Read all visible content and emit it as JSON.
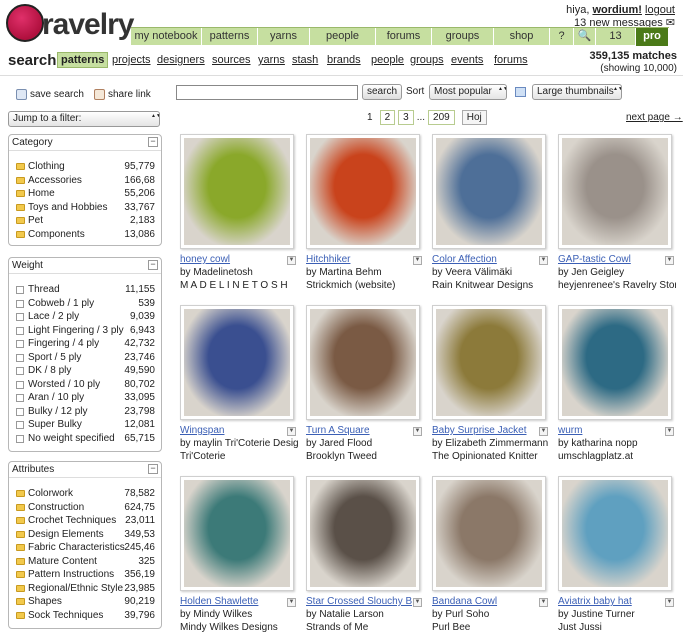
{
  "header": {
    "logo_text": "ravelry",
    "user_greeting": "hiya, ",
    "username": "wordium!",
    "logout": "logout",
    "messages": "13 new messages"
  },
  "nav": {
    "tabs": [
      "my notebook",
      "patterns",
      "yarns",
      "people",
      "forums",
      "groups",
      "shop",
      "?",
      "🔍",
      "13",
      "pro"
    ]
  },
  "subnav": {
    "title": "search",
    "items": [
      "patterns",
      "projects",
      "designers",
      "sources",
      "yarns",
      "stash",
      "brands",
      "people",
      "groups",
      "events",
      "forums"
    ],
    "active": "patterns"
  },
  "matches": {
    "count": "359,135 matches",
    "showing": "(showing 10,000)"
  },
  "toolbar": {
    "save_search": "save search",
    "share_link": "share link",
    "search_button": "search",
    "sort_label": "Sort",
    "sort_value": "Most popular",
    "view_value": "Large thumbnails",
    "search_value": ""
  },
  "jump": {
    "label": "Jump to a filter:"
  },
  "pager": {
    "pages": [
      "1",
      "2",
      "3",
      "...",
      "209"
    ],
    "current": "1",
    "per_page": "Hoj",
    "next": "next page →"
  },
  "filters": {
    "category": {
      "title": "Category",
      "items": [
        {
          "label": "Clothing",
          "count": "95,779"
        },
        {
          "label": "Accessories",
          "count": "166,68"
        },
        {
          "label": "Home",
          "count": "55,206"
        },
        {
          "label": "Toys and Hobbies",
          "count": "33,767"
        },
        {
          "label": "Pet",
          "count": "2,183"
        },
        {
          "label": "Components",
          "count": "13,086"
        }
      ]
    },
    "weight": {
      "title": "Weight",
      "items": [
        {
          "label": "Thread",
          "count": "11,155"
        },
        {
          "label": "Cobweb / 1 ply",
          "count": "539"
        },
        {
          "label": "Lace / 2 ply",
          "count": "9,039"
        },
        {
          "label": "Light Fingering / 3 ply",
          "count": "6,943"
        },
        {
          "label": "Fingering / 4 ply",
          "count": "42,732"
        },
        {
          "label": "Sport / 5 ply",
          "count": "23,746"
        },
        {
          "label": "DK / 8 ply",
          "count": "49,590"
        },
        {
          "label": "Worsted / 10 ply",
          "count": "80,702"
        },
        {
          "label": "Aran / 10 ply",
          "count": "33,095"
        },
        {
          "label": "Bulky / 12 ply",
          "count": "23,798"
        },
        {
          "label": "Super Bulky",
          "count": "12,081"
        },
        {
          "label": "No weight specified",
          "count": "65,715"
        }
      ]
    },
    "attributes": {
      "title": "Attributes",
      "items": [
        {
          "label": "Colorwork",
          "count": "78,582"
        },
        {
          "label": "Construction",
          "count": "624,75"
        },
        {
          "label": "Crochet Techniques",
          "count": "23,011"
        },
        {
          "label": "Design Elements",
          "count": "349,53"
        },
        {
          "label": "Fabric Characteristics",
          "count": "245,46"
        },
        {
          "label": "Mature Content",
          "count": "325"
        },
        {
          "label": "Pattern Instructions",
          "count": "356,19"
        },
        {
          "label": "Regional/Ethnic Style",
          "count": "23,985"
        },
        {
          "label": "Shapes",
          "count": "90,219"
        },
        {
          "label": "Sock Techniques",
          "count": "39,796"
        }
      ]
    }
  },
  "results": [
    {
      "title": "honey cowl",
      "by": "by Madelinetosh",
      "source": "M A D E L I N E T O S H",
      "color": "#8aa82a"
    },
    {
      "title": "Hitchhiker",
      "by": "by Martina Behm",
      "source": "Strickmich (website)",
      "color": "#c9431c"
    },
    {
      "title": "Color Affection",
      "by": "by Veera Välimäki",
      "source": "Rain Knitwear Designs",
      "color": "#4e6f98"
    },
    {
      "title": "GAP-tastic Cowl",
      "by": "by Jen Geigley",
      "source": "heyjenrenee's Ravelry Store",
      "color": "#9a918a"
    },
    {
      "title": "Wingspan",
      "by": "by maylin Tri'Coterie Designs",
      "source": "Tri'Coterie",
      "color": "#3a4f90"
    },
    {
      "title": "Turn A Square",
      "by": "by Jared Flood",
      "source": "Brooklyn Tweed",
      "color": "#7a5a44"
    },
    {
      "title": "Baby Surprise Jacket",
      "by": "by Elizabeth Zimmermann",
      "source": "The Opinionated Knitter",
      "color": "#8c7a3a"
    },
    {
      "title": "wurm",
      "by": "by katharina nopp",
      "source": "umschlagplatz.at",
      "color": "#2d6a84"
    },
    {
      "title": "Holden Shawlette",
      "by": "by Mindy Wilkes",
      "source": "Mindy Wilkes Designs",
      "color": "#3c7a78"
    },
    {
      "title": "Star Crossed Slouchy Beret",
      "by": "by Natalie Larson",
      "source": "Strands of Me",
      "color": "#5a5048"
    },
    {
      "title": "Bandana Cowl",
      "by": "by Purl Soho",
      "source": "Purl Bee",
      "color": "#8b7868"
    },
    {
      "title": "Aviatrix baby hat",
      "by": "by Justine Turner",
      "source": "Just Jussi",
      "color": "#5fa0c0"
    }
  ]
}
